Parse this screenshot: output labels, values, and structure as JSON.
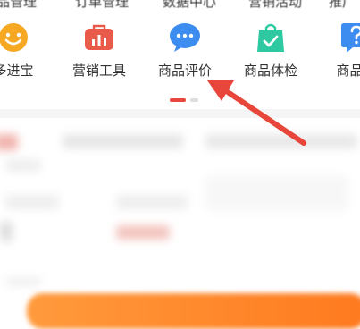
{
  "top_strip": [
    "品管理",
    "订单管理",
    "数据中心",
    "营销活动",
    "推广"
  ],
  "menu": {
    "items": [
      {
        "label": "多进宝",
        "icon": "smiling-face-icon",
        "color": "#f7a823"
      },
      {
        "label": "营销工具",
        "icon": "toolbox-icon",
        "color": "#ea5a4a"
      },
      {
        "label": "商品评价",
        "icon": "chat-bubble-icon",
        "color": "#3d8cf0"
      },
      {
        "label": "商品体检",
        "icon": "shopping-bag-check-icon",
        "color": "#2ec9a0"
      },
      {
        "label": "商品管",
        "icon": "question-icon",
        "color": "#3d8cf0"
      }
    ]
  },
  "pager": {
    "pages": 2,
    "current": 1,
    "active_color": "#e8463a",
    "inactive_color": "#dddddd"
  },
  "annotation": {
    "arrow_color": "#e8463a",
    "points_to": "商品评价"
  },
  "accent_orange": "#ff8a2a"
}
